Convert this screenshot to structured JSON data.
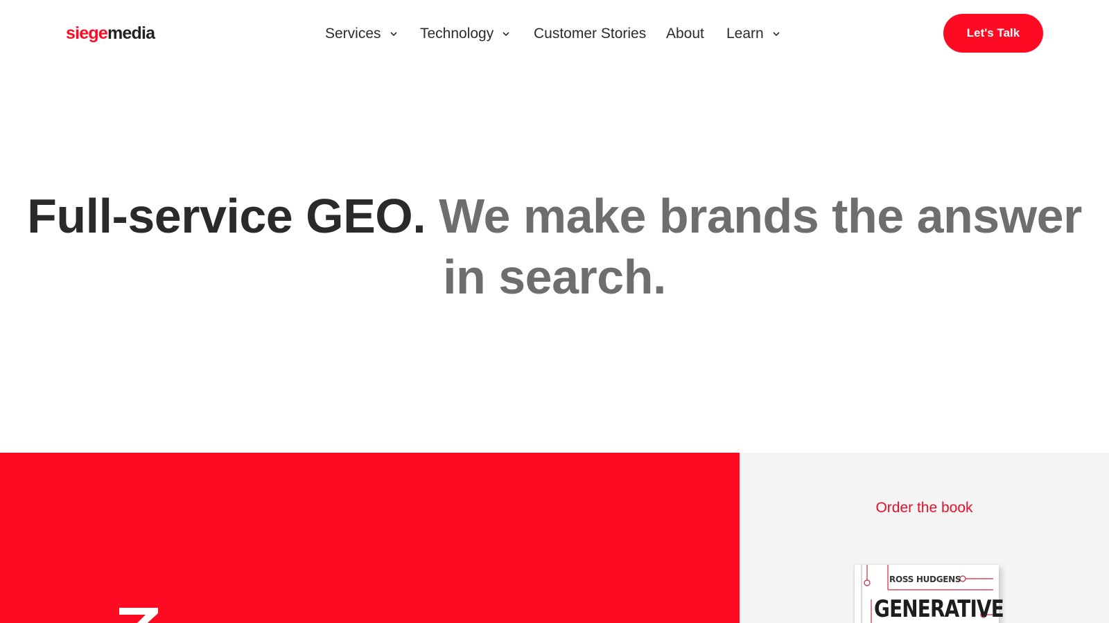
{
  "header": {
    "logo": {
      "part1": "siege",
      "part2": "media"
    },
    "nav": [
      {
        "label": "Services",
        "has_dropdown": true
      },
      {
        "label": "Technology",
        "has_dropdown": true
      },
      {
        "label": "Customer Stories",
        "has_dropdown": false
      },
      {
        "label": "About",
        "has_dropdown": false
      },
      {
        "label": "Learn",
        "has_dropdown": true
      }
    ],
    "cta_label": "Let's Talk"
  },
  "hero": {
    "headline_dark": "Full-service GEO.",
    "headline_gray": "We make brands the answer in search."
  },
  "book_panel": {
    "link_label": "Order the book",
    "book_author": "ROSS HUDGENS",
    "book_title": "GENERATIVE"
  },
  "colors": {
    "brand_red": "#ff0a23",
    "text_dark": "#2a2a2a",
    "text_gray": "#6e6e6e",
    "panel_gray": "#f4f4f4"
  },
  "icons": {
    "nav_dropdown": "chevron-down-icon"
  }
}
